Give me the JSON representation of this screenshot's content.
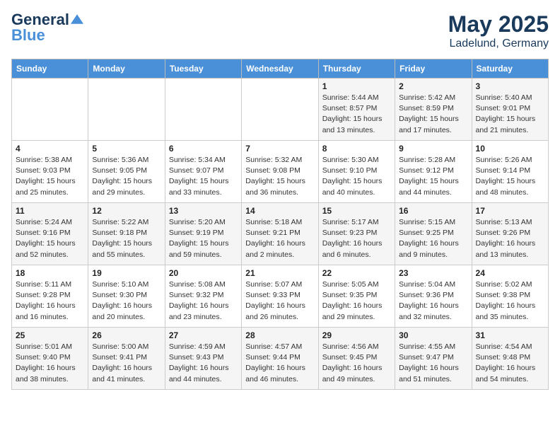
{
  "header": {
    "logo_line1": "General",
    "logo_line2": "Blue",
    "month": "May 2025",
    "location": "Ladelund, Germany"
  },
  "weekdays": [
    "Sunday",
    "Monday",
    "Tuesday",
    "Wednesday",
    "Thursday",
    "Friday",
    "Saturday"
  ],
  "weeks": [
    [
      {
        "day": "",
        "detail": ""
      },
      {
        "day": "",
        "detail": ""
      },
      {
        "day": "",
        "detail": ""
      },
      {
        "day": "",
        "detail": ""
      },
      {
        "day": "1",
        "detail": "Sunrise: 5:44 AM\nSunset: 8:57 PM\nDaylight: 15 hours\nand 13 minutes."
      },
      {
        "day": "2",
        "detail": "Sunrise: 5:42 AM\nSunset: 8:59 PM\nDaylight: 15 hours\nand 17 minutes."
      },
      {
        "day": "3",
        "detail": "Sunrise: 5:40 AM\nSunset: 9:01 PM\nDaylight: 15 hours\nand 21 minutes."
      }
    ],
    [
      {
        "day": "4",
        "detail": "Sunrise: 5:38 AM\nSunset: 9:03 PM\nDaylight: 15 hours\nand 25 minutes."
      },
      {
        "day": "5",
        "detail": "Sunrise: 5:36 AM\nSunset: 9:05 PM\nDaylight: 15 hours\nand 29 minutes."
      },
      {
        "day": "6",
        "detail": "Sunrise: 5:34 AM\nSunset: 9:07 PM\nDaylight: 15 hours\nand 33 minutes."
      },
      {
        "day": "7",
        "detail": "Sunrise: 5:32 AM\nSunset: 9:08 PM\nDaylight: 15 hours\nand 36 minutes."
      },
      {
        "day": "8",
        "detail": "Sunrise: 5:30 AM\nSunset: 9:10 PM\nDaylight: 15 hours\nand 40 minutes."
      },
      {
        "day": "9",
        "detail": "Sunrise: 5:28 AM\nSunset: 9:12 PM\nDaylight: 15 hours\nand 44 minutes."
      },
      {
        "day": "10",
        "detail": "Sunrise: 5:26 AM\nSunset: 9:14 PM\nDaylight: 15 hours\nand 48 minutes."
      }
    ],
    [
      {
        "day": "11",
        "detail": "Sunrise: 5:24 AM\nSunset: 9:16 PM\nDaylight: 15 hours\nand 52 minutes."
      },
      {
        "day": "12",
        "detail": "Sunrise: 5:22 AM\nSunset: 9:18 PM\nDaylight: 15 hours\nand 55 minutes."
      },
      {
        "day": "13",
        "detail": "Sunrise: 5:20 AM\nSunset: 9:19 PM\nDaylight: 15 hours\nand 59 minutes."
      },
      {
        "day": "14",
        "detail": "Sunrise: 5:18 AM\nSunset: 9:21 PM\nDaylight: 16 hours\nand 2 minutes."
      },
      {
        "day": "15",
        "detail": "Sunrise: 5:17 AM\nSunset: 9:23 PM\nDaylight: 16 hours\nand 6 minutes."
      },
      {
        "day": "16",
        "detail": "Sunrise: 5:15 AM\nSunset: 9:25 PM\nDaylight: 16 hours\nand 9 minutes."
      },
      {
        "day": "17",
        "detail": "Sunrise: 5:13 AM\nSunset: 9:26 PM\nDaylight: 16 hours\nand 13 minutes."
      }
    ],
    [
      {
        "day": "18",
        "detail": "Sunrise: 5:11 AM\nSunset: 9:28 PM\nDaylight: 16 hours\nand 16 minutes."
      },
      {
        "day": "19",
        "detail": "Sunrise: 5:10 AM\nSunset: 9:30 PM\nDaylight: 16 hours\nand 20 minutes."
      },
      {
        "day": "20",
        "detail": "Sunrise: 5:08 AM\nSunset: 9:32 PM\nDaylight: 16 hours\nand 23 minutes."
      },
      {
        "day": "21",
        "detail": "Sunrise: 5:07 AM\nSunset: 9:33 PM\nDaylight: 16 hours\nand 26 minutes."
      },
      {
        "day": "22",
        "detail": "Sunrise: 5:05 AM\nSunset: 9:35 PM\nDaylight: 16 hours\nand 29 minutes."
      },
      {
        "day": "23",
        "detail": "Sunrise: 5:04 AM\nSunset: 9:36 PM\nDaylight: 16 hours\nand 32 minutes."
      },
      {
        "day": "24",
        "detail": "Sunrise: 5:02 AM\nSunset: 9:38 PM\nDaylight: 16 hours\nand 35 minutes."
      }
    ],
    [
      {
        "day": "25",
        "detail": "Sunrise: 5:01 AM\nSunset: 9:40 PM\nDaylight: 16 hours\nand 38 minutes."
      },
      {
        "day": "26",
        "detail": "Sunrise: 5:00 AM\nSunset: 9:41 PM\nDaylight: 16 hours\nand 41 minutes."
      },
      {
        "day": "27",
        "detail": "Sunrise: 4:59 AM\nSunset: 9:43 PM\nDaylight: 16 hours\nand 44 minutes."
      },
      {
        "day": "28",
        "detail": "Sunrise: 4:57 AM\nSunset: 9:44 PM\nDaylight: 16 hours\nand 46 minutes."
      },
      {
        "day": "29",
        "detail": "Sunrise: 4:56 AM\nSunset: 9:45 PM\nDaylight: 16 hours\nand 49 minutes."
      },
      {
        "day": "30",
        "detail": "Sunrise: 4:55 AM\nSunset: 9:47 PM\nDaylight: 16 hours\nand 51 minutes."
      },
      {
        "day": "31",
        "detail": "Sunrise: 4:54 AM\nSunset: 9:48 PM\nDaylight: 16 hours\nand 54 minutes."
      }
    ]
  ]
}
